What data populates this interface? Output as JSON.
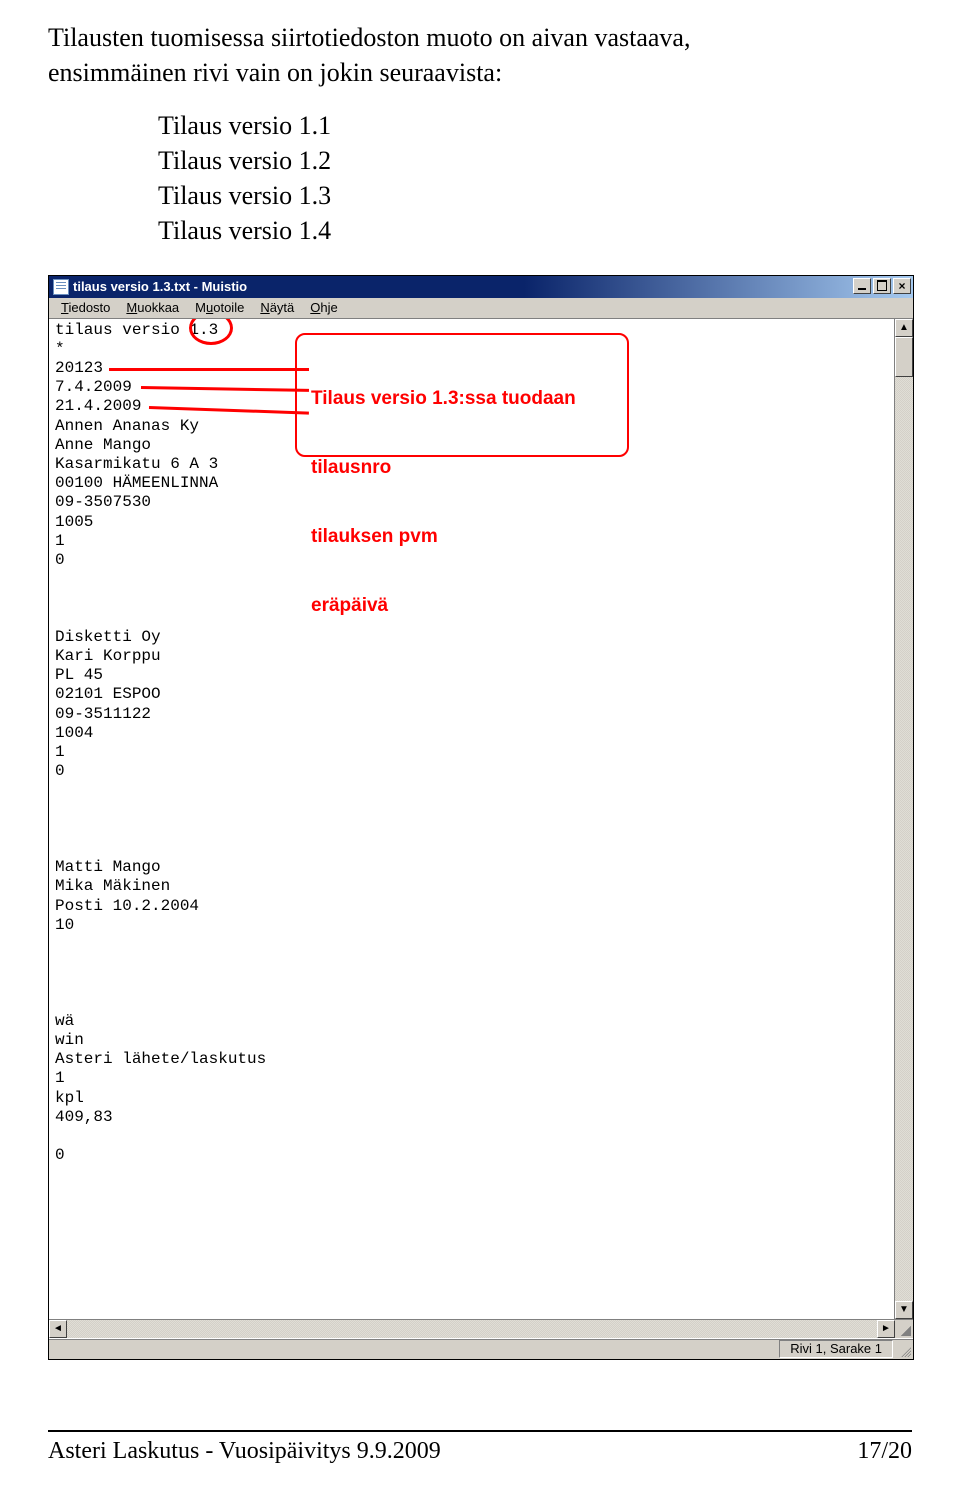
{
  "intro": {
    "line1": "Tilausten tuomisessa siirtotiedoston muoto on aivan vastaava,",
    "line2": "ensimmäinen rivi vain on jokin seuraavista:"
  },
  "versions": [
    "Tilaus versio 1.1",
    "Tilaus versio 1.2",
    "Tilaus versio 1.3",
    "Tilaus versio 1.4"
  ],
  "window": {
    "title": "tilaus versio 1.3.txt - Muistio"
  },
  "menu": {
    "file": "Tiedosto",
    "edit": "Muokkaa",
    "format": "Muotoile",
    "view": "Näytä",
    "help": "Ohje"
  },
  "notepad_lines": [
    "tilaus versio 1.3",
    "*",
    "20123",
    "7.4.2009",
    "21.4.2009",
    "Annen Ananas Ky",
    "Anne Mango",
    "Kasarmikatu 6 A 3",
    "00100 HÄMEENLINNA",
    "09-3507530",
    "1005",
    "1",
    "0",
    "",
    "",
    "",
    "Disketti Oy",
    "Kari Korppu",
    "PL 45",
    "02101 ESPOO",
    "09-3511122",
    "1004",
    "1",
    "0",
    "",
    "",
    "",
    "",
    "Matti Mango",
    "Mika Mäkinen",
    "Posti 10.2.2004",
    "10",
    "",
    "",
    "",
    "",
    "wä",
    "win",
    "Asteri lähete/laskutus",
    "1",
    "kpl",
    "409,83",
    "",
    "0"
  ],
  "annotation": {
    "line1": "Tilaus versio 1.3:ssa tuodaan",
    "line2": "tilausnro",
    "line3": "tilauksen pvm",
    "line4": "eräpäivä"
  },
  "status": "Rivi 1, Sarake 1",
  "footer": {
    "left": "Asteri Laskutus - Vuosipäivitys 9.9.2009",
    "right": "17/20"
  }
}
